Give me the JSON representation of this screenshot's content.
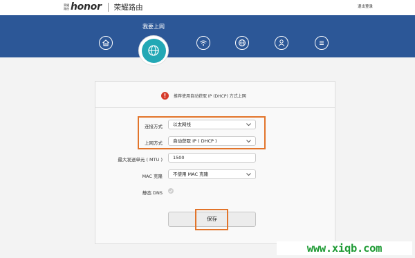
{
  "header": {
    "brand_mark_top": "荣耀",
    "brand_mark_bottom": "路由",
    "brand_logo": "honor",
    "product_name": "荣耀路由",
    "logout_label": "退出登录"
  },
  "nav": {
    "active_label": "我要上网",
    "items": [
      {
        "icon": "home-icon"
      },
      {
        "icon": "globe-icon",
        "active": true
      },
      {
        "icon": "wifi-icon"
      },
      {
        "icon": "network-globe-icon"
      },
      {
        "icon": "user-icon"
      },
      {
        "icon": "menu-icon"
      }
    ]
  },
  "notice": {
    "icon": "warning-icon",
    "icon_glyph": "!",
    "text": "推荐使用自动获取 IP (DHCP) 方式上网"
  },
  "form": {
    "connection_mode": {
      "label": "连接方式",
      "value": "以太网线"
    },
    "internet_mode": {
      "label": "上网方式",
      "value": "自动获取 IP ( DHCP )"
    },
    "mtu": {
      "label": "最大发送单元 ( MTU )",
      "value": "1500"
    },
    "mac_clone": {
      "label": "MAC 克隆",
      "value": "不使用 MAC 克隆"
    },
    "static_dns": {
      "label": "静态 DNS",
      "checked": true
    }
  },
  "save_label": "保存",
  "watermark": "www.xiqb.com",
  "colors": {
    "nav_blue": "#2c5797",
    "active_teal": "#23a8b5",
    "highlight_orange": "#e2742a",
    "warning_red": "#d63b2a",
    "watermark_green": "#1f9b35"
  }
}
